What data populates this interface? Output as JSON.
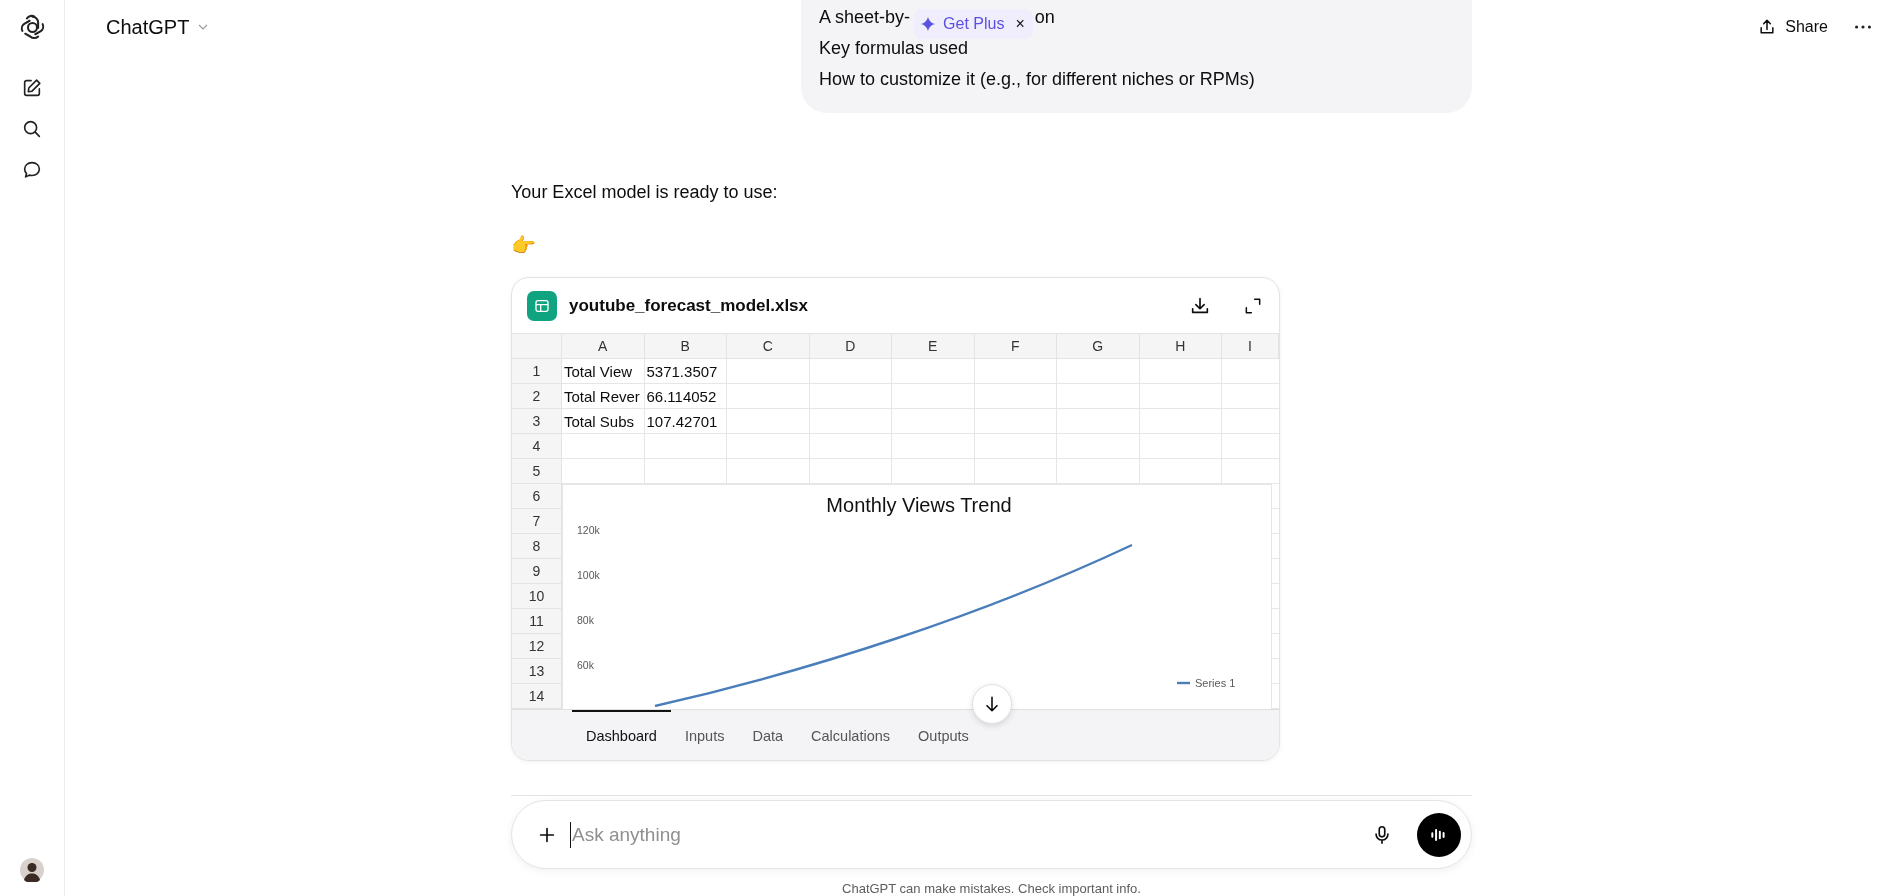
{
  "header": {
    "title": "ChatGPT",
    "share": "Share"
  },
  "user_message": {
    "line_1_start": "A sheet-by-",
    "line_1_end": "on",
    "lines": [
      "Key formulas used",
      "How to customize it (e.g., for different niches or RPMs)"
    ]
  },
  "upsell": {
    "label": "Get Plus",
    "close": "×"
  },
  "assistant": {
    "text": "Your Excel model is ready to use:",
    "emoji": "👉"
  },
  "file": {
    "name": "youtube_forecast_model.xlsx",
    "columns": [
      "A",
      "B",
      "C",
      "D",
      "E",
      "F",
      "G",
      "H",
      "I"
    ],
    "rows": [
      {
        "number": "1",
        "cells": [
          "Total View",
          "5371.3507"
        ]
      },
      {
        "number": "2",
        "cells": [
          "Total Rever",
          "66.114052"
        ]
      },
      {
        "number": "3",
        "cells": [
          "Total Subs",
          "107.42701"
        ]
      },
      {
        "number": "4",
        "cells": []
      },
      {
        "number": "5",
        "cells": []
      },
      {
        "number": "6",
        "cells": []
      },
      {
        "number": "7",
        "cells": []
      },
      {
        "number": "8",
        "cells": []
      },
      {
        "number": "9",
        "cells": []
      },
      {
        "number": "10",
        "cells": []
      },
      {
        "number": "11",
        "cells": []
      },
      {
        "number": "12",
        "cells": []
      },
      {
        "number": "13",
        "cells": []
      },
      {
        "number": "14",
        "cells": []
      }
    ],
    "chart": {
      "title": "Monthly Views Trend",
      "y_axis_labels": [
        "120k",
        "100k",
        "80k",
        "60k"
      ],
      "legend": "Series 1"
    },
    "sheet_tabs": [
      {
        "label": "Dashboard",
        "selected": true
      },
      {
        "label": "Inputs",
        "selected": false
      },
      {
        "label": "Data",
        "selected": false
      },
      {
        "label": "Calculations",
        "selected": false
      },
      {
        "label": "Outputs",
        "selected": false
      }
    ]
  },
  "composer": {
    "placeholder": "Ask anything"
  },
  "disclaimer": "ChatGPT can make mistakes. Check important info."
}
